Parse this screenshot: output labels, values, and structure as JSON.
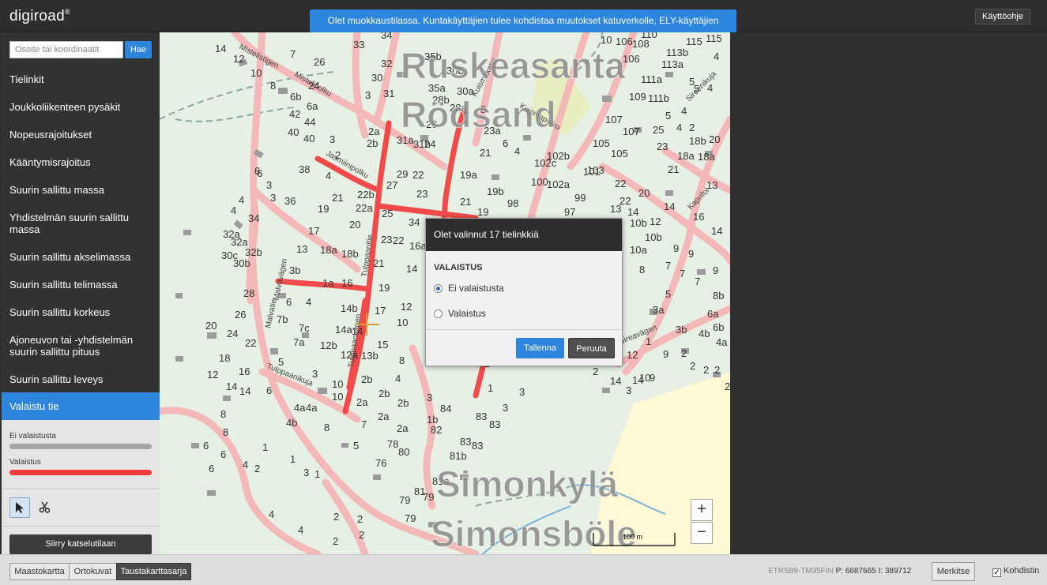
{
  "header": {
    "logo": "digiroad",
    "logo_mark": "®",
    "notice": "Olet muokkaustilassa. Kuntakäyttäjien tulee kohdistaa muutokset katuverkolle, ELY-käyttäjien maantieverkolle.",
    "help_label": "Käyttöohje"
  },
  "search": {
    "placeholder": "Osoite tai koordinaatit",
    "value": "",
    "button_label": "Hae"
  },
  "sidebar": {
    "items": [
      {
        "label": "Tielinkit"
      },
      {
        "label": "Joukkoliikenteen pysäkit"
      },
      {
        "label": "Nopeusrajoitukset"
      },
      {
        "label": "Kääntymisrajoitus"
      },
      {
        "label": "Suurin sallittu massa"
      },
      {
        "label": "Yhdistelmän suurin sallittu massa"
      },
      {
        "label": "Suurin sallittu akselimassa"
      },
      {
        "label": "Suurin sallittu telimassa"
      },
      {
        "label": "Suurin sallittu korkeus"
      },
      {
        "label": "Ajoneuvon tai -yhdistelmän suurin sallittu pituus"
      },
      {
        "label": "Suurin sallittu leveys"
      },
      {
        "label": "Valaistu tie"
      }
    ],
    "active_item": "Valaistu tie",
    "legend": [
      {
        "label": "Ei valaistusta",
        "color": "#a6a6a6"
      },
      {
        "label": "Valaistus",
        "color": "#f23a3a"
      }
    ],
    "tools": [
      {
        "icon": "cursor-arrow-icon",
        "selected": true
      },
      {
        "icon": "scissors-icon",
        "selected": false
      }
    ],
    "mode_button": "Siirry katselutilaan"
  },
  "map": {
    "place_names": [
      {
        "text": "Ruskeasanta"
      },
      {
        "text": "Rödsand"
      },
      {
        "text": "Simonkylä"
      },
      {
        "text": "Simonsböle"
      }
    ],
    "streets": [
      "Mistelistigen",
      "Mistelipolku",
      "Jasmiinipolku",
      "Malvatie",
      "Malvavägen",
      "Tulppaanitie",
      "Tulppaanikuja",
      "Kuismapolku",
      "Kuismakatie",
      "Sireenikuja",
      "Kaprifol",
      "Tulppaanvägen",
      "Sireavägen"
    ],
    "house_numbers": [
      "14",
      "12",
      "10",
      "8",
      "7",
      "26",
      "24",
      "33",
      "32",
      "31",
      "30",
      "35b",
      "35a",
      "34",
      "28b",
      "28a",
      "29",
      "22",
      "21",
      "19",
      "1",
      "3",
      "5",
      "6a",
      "6b",
      "42",
      "44",
      "40",
      "3",
      "2a",
      "2b",
      "1b",
      "31a",
      "31b",
      "3",
      "4",
      "38",
      "36",
      "27",
      "25",
      "23",
      "22b",
      "22a",
      "20",
      "19",
      "17",
      "18a",
      "18b",
      "16",
      "15",
      "14b",
      "14a",
      "14",
      "12",
      "10",
      "12a",
      "12b",
      "13a",
      "13b",
      "8",
      "7a",
      "7b",
      "7c",
      "6",
      "4",
      "3b",
      "28",
      "26",
      "24",
      "22",
      "20",
      "18",
      "16",
      "14",
      "12",
      "10",
      "8",
      "6",
      "4",
      "2",
      "1",
      "3",
      "5",
      "9",
      "11",
      "32a",
      "32b",
      "30b",
      "30c",
      "4",
      "2a",
      "2b",
      "4a",
      "4b",
      "10",
      "84",
      "83",
      "82",
      "81b",
      "81a",
      "80",
      "79",
      "78",
      "76",
      "23a",
      "6",
      "4",
      "102b",
      "102c",
      "100",
      "102a",
      "99",
      "97",
      "98",
      "101",
      "103",
      "105",
      "107",
      "109",
      "111a",
      "111b",
      "113a",
      "113b",
      "115",
      "106",
      "108",
      "110",
      "104",
      "10",
      "8",
      "3a",
      "3b",
      "4b",
      "4a",
      "7",
      "7",
      "8b",
      "6a",
      "6b",
      "5",
      "9",
      "11",
      "12",
      "13",
      "14",
      "15",
      "16",
      "17",
      "18a",
      "18b",
      "19",
      "20",
      "21",
      "22",
      "23",
      "24",
      "25"
    ],
    "zoom_in": "+",
    "zoom_out": "−",
    "scale": "100 m"
  },
  "dialog": {
    "title": "Olet valinnut 17 tielinkkiä",
    "section": "VALAISTUS",
    "options": [
      {
        "label": "Ei valaistusta",
        "checked": true
      },
      {
        "label": "Valaistus",
        "checked": false
      }
    ],
    "save_label": "Tallenna",
    "cancel_label": "Peruuta"
  },
  "footer": {
    "background_layers": [
      {
        "label": "Maastokartta",
        "active": false
      },
      {
        "label": "Ortokuvat",
        "active": false
      },
      {
        "label": "Taustakarttasarja",
        "active": true
      }
    ],
    "projection": "ETRS89-TM35FIN",
    "p_label": "P:",
    "p_value": "6687665",
    "i_label": "I:",
    "i_value": "389712",
    "mark_label": "Merkitse",
    "crosshair_label": "Kohdistin",
    "crosshair_checked": true
  }
}
